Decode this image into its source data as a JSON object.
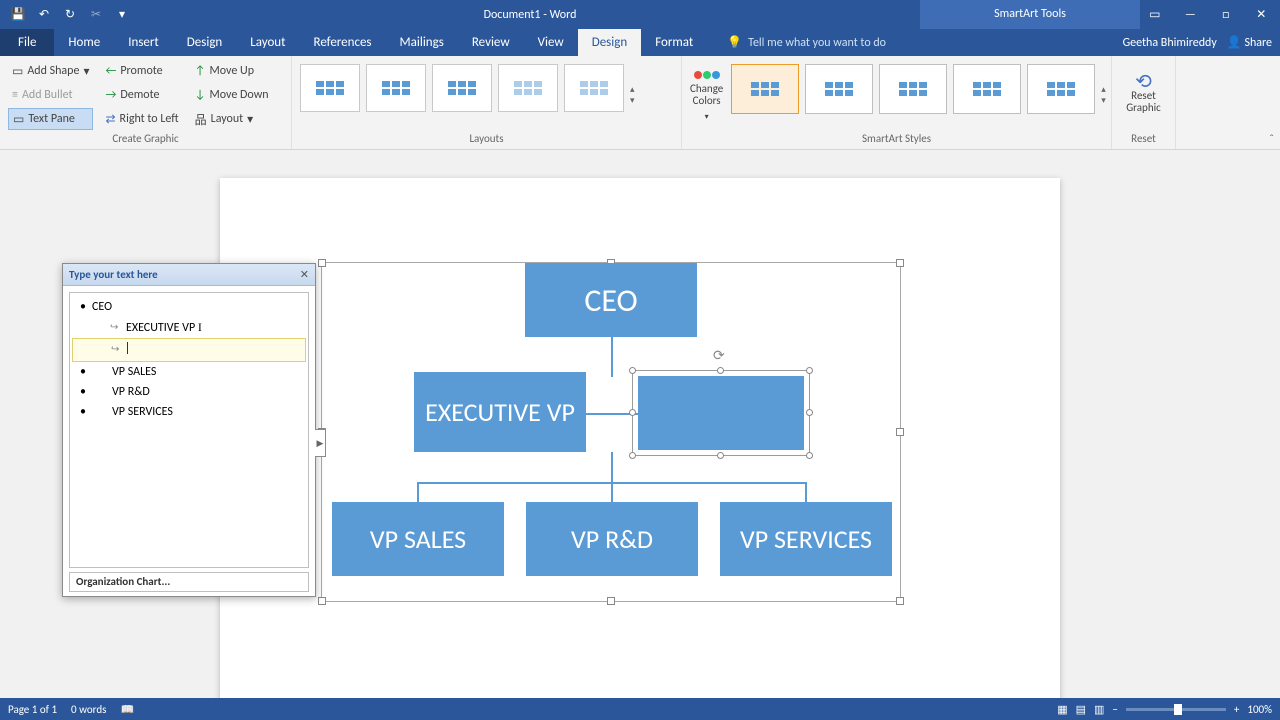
{
  "titlebar": {
    "title": "Document1 - Word",
    "tools_title": "SmartArt Tools"
  },
  "tabs": {
    "file": "File",
    "items": [
      "Home",
      "Insert",
      "Design",
      "Layout",
      "References",
      "Mailings",
      "Review",
      "View",
      "Design",
      "Format"
    ],
    "active_index": 8,
    "tell_me": "Tell me what you want to do",
    "user": "Geetha Bhimireddy",
    "share": "Share"
  },
  "ribbon": {
    "create_graphic": {
      "label": "Create Graphic",
      "add_shape": "Add Shape",
      "add_bullet": "Add Bullet",
      "text_pane": "Text Pane",
      "promote": "Promote",
      "demote": "Demote",
      "rtl": "Right to Left",
      "move_up": "Move Up",
      "move_down": "Move Down",
      "layout": "Layout"
    },
    "layouts_label": "Layouts",
    "change_colors": "Change Colors",
    "styles_label": "SmartArt Styles",
    "reset_graphic": "Reset Graphic",
    "reset_label": "Reset"
  },
  "text_pane": {
    "header": "Type your text here",
    "items": [
      {
        "level": 0,
        "text": "CEO"
      },
      {
        "level": 1,
        "text": "EXECUTIVE VP",
        "sub": true
      },
      {
        "level": 1,
        "text": "",
        "sub": true,
        "selected": true
      },
      {
        "level": 1,
        "text": "VP SALES"
      },
      {
        "level": 1,
        "text": "VP R&D"
      },
      {
        "level": 1,
        "text": "VP SERVICES"
      }
    ],
    "footer": "Organization Chart..."
  },
  "smartart": {
    "ceo": "CEO",
    "exec": "EXECUTIVE VP",
    "vp1": "VP SALES",
    "vp2": "VP R&D",
    "vp3": "VP SERVICES"
  },
  "statusbar": {
    "page": "Page 1 of 1",
    "words": "0 words",
    "zoom": "100%"
  }
}
